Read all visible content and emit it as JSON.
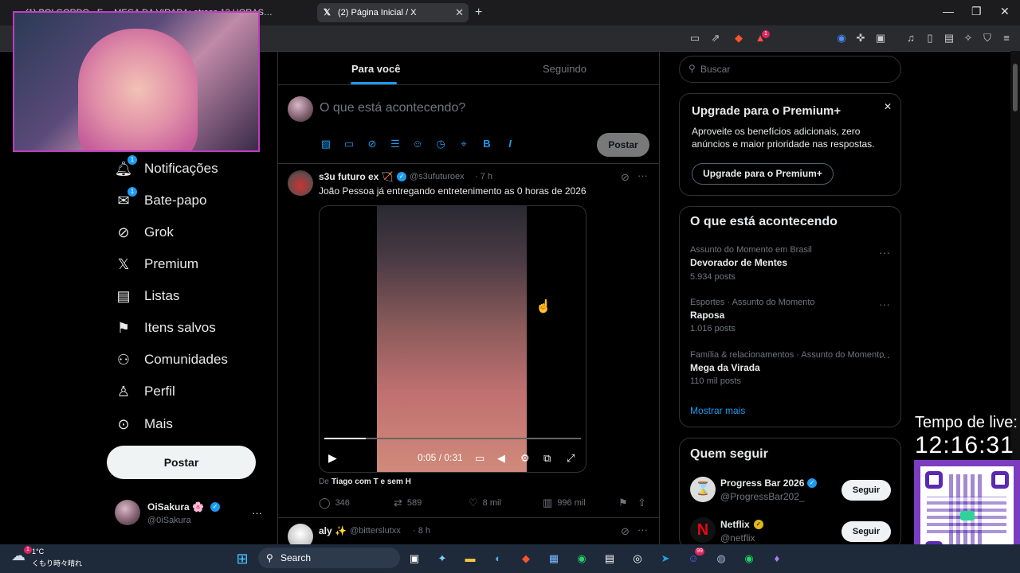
{
  "browser": {
    "tab1_title": "(1) BOLGORDO - E… MEGA DA VIRADA: atrasa 12 HORAS…",
    "tab2_title": "(2) Página Inicial / X",
    "close_glyph": "✕",
    "new_tab_glyph": "+",
    "extension_badge": "1"
  },
  "nav": {
    "items": [
      {
        "label": "Notificações",
        "icon": "bell-icon",
        "badge": "1"
      },
      {
        "label": "Bate-papo",
        "icon": "mail-icon",
        "badge": "1"
      },
      {
        "label": "Grok",
        "icon": "grok-icon",
        "badge": ""
      },
      {
        "label": "Premium",
        "icon": "x-logo-icon",
        "badge": ""
      },
      {
        "label": "Listas",
        "icon": "list-icon",
        "badge": ""
      },
      {
        "label": "Itens salvos",
        "icon": "bookmark-icon",
        "badge": ""
      },
      {
        "label": "Comunidades",
        "icon": "communities-icon",
        "badge": ""
      },
      {
        "label": "Perfil",
        "icon": "person-icon",
        "badge": ""
      },
      {
        "label": "Mais",
        "icon": "more-circle-icon",
        "badge": ""
      }
    ],
    "post_button": "Postar",
    "account_name": "OiSakura 🌸",
    "account_handle": "@0iSakura",
    "account_more": "···"
  },
  "feed": {
    "tabs": [
      "Para você",
      "Seguindo"
    ],
    "compose_placeholder": "O que está acontecendo?",
    "compose_post_button": "Postar",
    "post1": {
      "author": "s3u futuro ex 🏹",
      "handle": "@s3ufuturoex",
      "time": "· 7 h",
      "text": "João Pessoa já entregando entretenimento as 0 horas de 2026",
      "video_time": "0:05 / 0:31",
      "video_progress": 0.16,
      "credit_prefix": "De",
      "credit_name": "Tiago com T e sem H",
      "replies": "346",
      "reposts": "589",
      "likes": "8 mil",
      "views": "996 mil"
    },
    "post2": {
      "author": "aly ✨",
      "handle": "@bitterslutxx",
      "time": "· 8 h"
    }
  },
  "right": {
    "search_placeholder": "Buscar",
    "premium": {
      "title": "Upgrade para o Premium+",
      "body": "Aproveite os benefícios adicionais, zero anúncios e maior prioridade nas respostas.",
      "button": "Upgrade para o Premium+",
      "close_glyph": "✕"
    },
    "trending": {
      "title": "O que está acontecendo",
      "items": [
        {
          "context": "Assunto do Momento em Brasil",
          "name": "Devorador de Mentes",
          "posts": "5.934 posts"
        },
        {
          "context": "Esportes · Assunto do Momento",
          "name": "Raposa",
          "posts": "1.016 posts"
        },
        {
          "context": "Família & relacionamentos · Assunto do Momento",
          "name": "Mega da Virada",
          "posts": "110 mil posts"
        }
      ],
      "show_more": "Mostrar mais"
    },
    "who_to_follow": {
      "title": "Quem seguir",
      "items": [
        {
          "name": "Progress Bar 2026",
          "handle": "@ProgressBar202_",
          "button": "Seguir"
        },
        {
          "name": "Netflix",
          "handle": "@netflix",
          "button": "Seguir"
        }
      ]
    }
  },
  "overlay": {
    "live_label": "Tempo de live:",
    "live_time": "12:16:31"
  },
  "taskbar": {
    "weather_temp": "1°C",
    "weather_desc": "くもり時々晴れ",
    "weather_badge": "1",
    "search_label": "Search",
    "discord_badge": "99"
  },
  "colors": {
    "accent": "#1d9bf0",
    "qr_border": "#7b3cc0"
  }
}
